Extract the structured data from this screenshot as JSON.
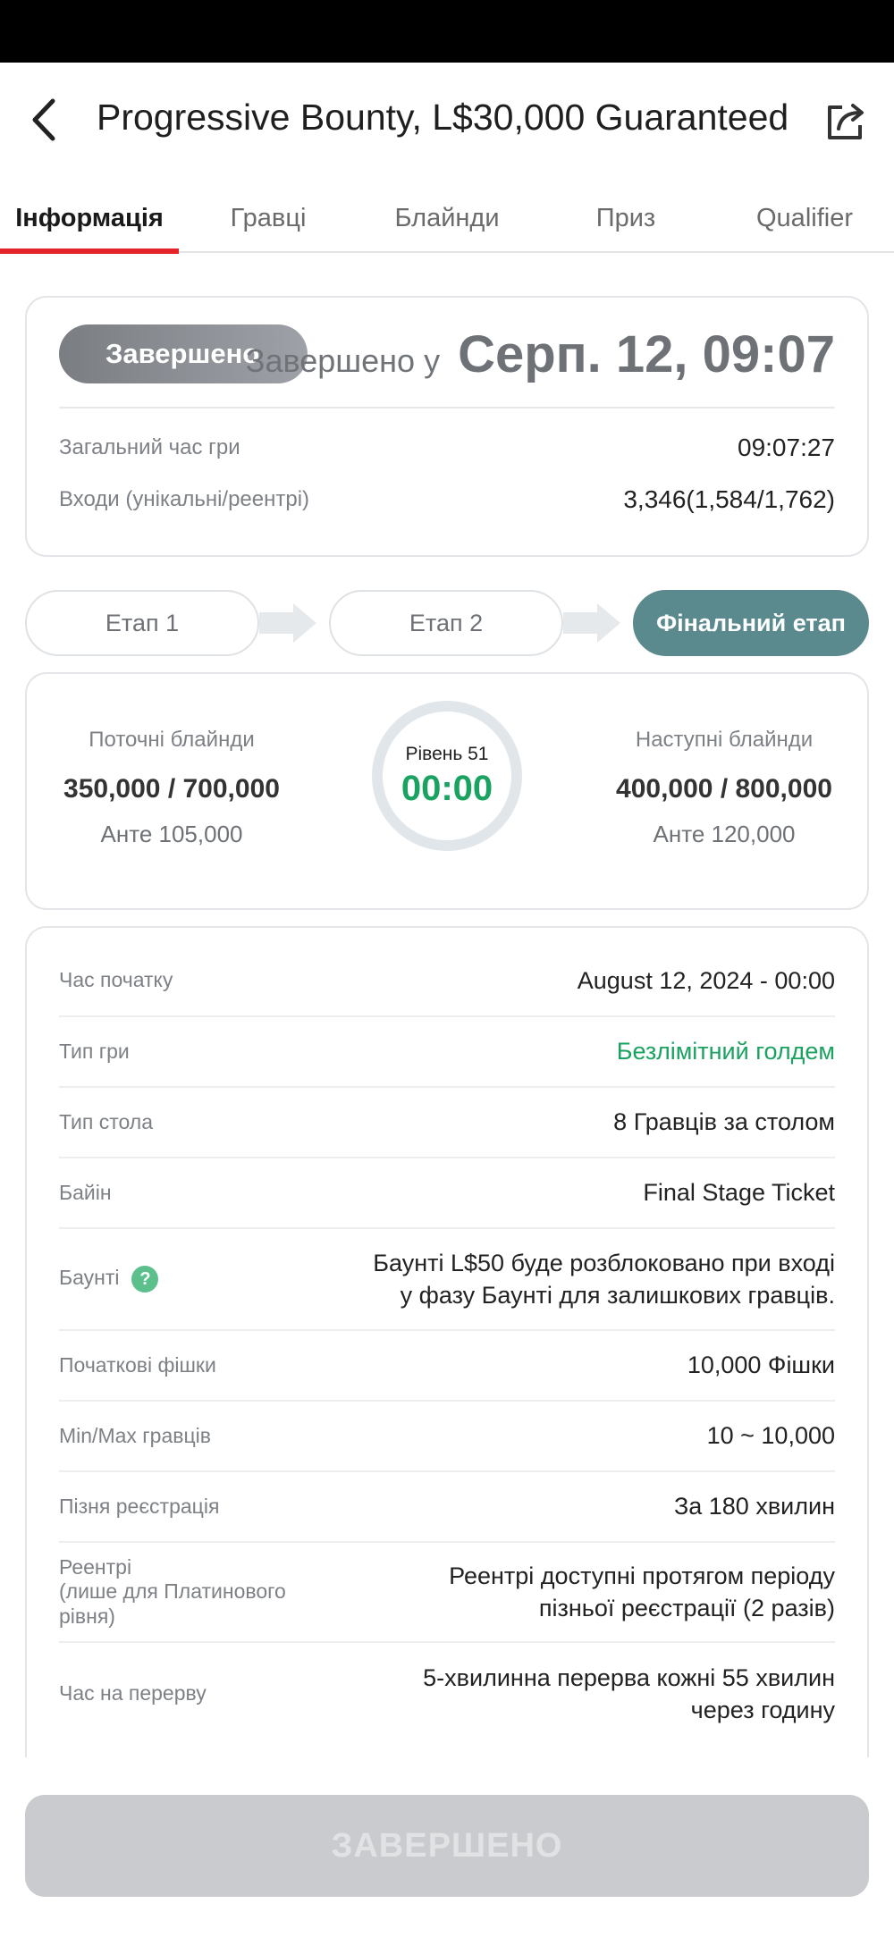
{
  "header": {
    "title": "Progressive Bounty, L$30,000 Guaranteed",
    "back_icon": "chevron-left-icon",
    "share_icon": "share-icon"
  },
  "tabs": [
    {
      "label": "Інформація",
      "active": true
    },
    {
      "label": "Гравці",
      "active": false
    },
    {
      "label": "Блайнди",
      "active": false
    },
    {
      "label": "Приз",
      "active": false
    },
    {
      "label": "Qualifier",
      "active": false
    }
  ],
  "status": {
    "badge": "Завершено",
    "finished_label": "Завершено у",
    "finished_value": "Серп. 12, 09:07",
    "total_time_label": "Загальний час гри",
    "total_time_value": "09:07:27",
    "entries_label": "Входи (унікальні/реентрі)",
    "entries_value": "3,346(1,584/1,762)"
  },
  "stages": [
    {
      "label": "Етап 1",
      "active": false
    },
    {
      "label": "Етап 2",
      "active": false
    },
    {
      "label": "Фінальний етап",
      "active": true
    }
  ],
  "blinds": {
    "current_label": "Поточні блайнди",
    "current_value": "350,000 / 700,000",
    "current_ante": "Анте 105,000",
    "level": "Рівень 51",
    "timer": "00:00",
    "next_label": "Наступні блайнди",
    "next_value": "400,000 / 800,000",
    "next_ante": "Анте 120,000"
  },
  "info": {
    "start_time_label": "Час початку",
    "start_time_value": "August 12, 2024 - 00:00",
    "game_type_label": "Тип гри",
    "game_type_value": "Безлімітний голдем",
    "table_type_label": "Тип стола",
    "table_type_value": "8 Гравців за столом",
    "buyin_label": "Байін",
    "buyin_value": "Final Stage Ticket",
    "bounty_label": "Баунті",
    "bounty_help_icon": "question-icon",
    "bounty_line1": "Баунті L$50 буде розблоковано при вході",
    "bounty_line2": "у фазу Баунті для залишкових гравців.",
    "chips_label": "Початкові фішки",
    "chips_value": "10,000 Фішки",
    "players_label": "Min/Max гравців",
    "players_value": "10 ~ 10,000",
    "late_reg_label": "Пізня реєстрація",
    "late_reg_value": "За 180 хвилин",
    "reentry_label_1": "Реентрі",
    "reentry_label_2": "(лише для Платинового",
    "reentry_label_3": "рівня)",
    "reentry_line1": "Реентрі доступні протягом періоду",
    "reentry_line2": "пізньої реєстрації (2 разів)",
    "break_label": "Час на перерву",
    "break_line1": "5-хвилинна перерва кожні 55 хвилин",
    "break_line2": "через годину"
  },
  "bottom": {
    "button_label": "ЗАВЕРШЕНО"
  },
  "colors": {
    "accent_red": "#e3242b",
    "green": "#1aa260",
    "stage_active": "#5a8a8e"
  }
}
